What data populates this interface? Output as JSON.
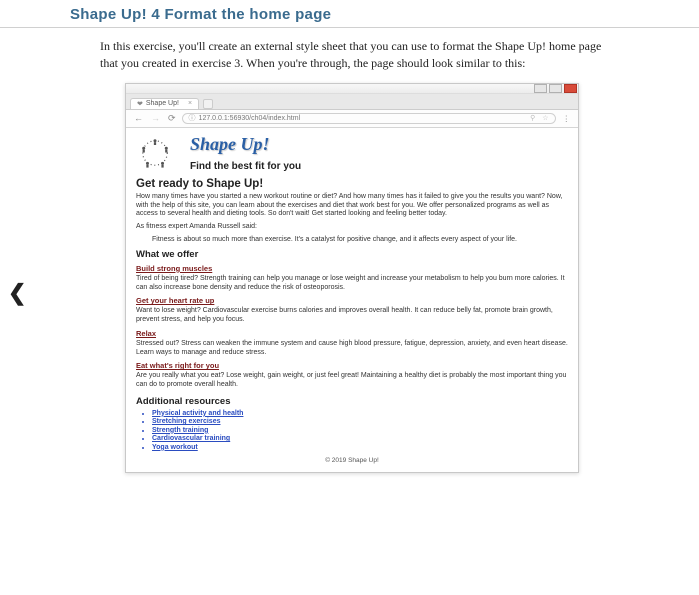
{
  "page_title": "Shape Up! 4  Format the home page",
  "intro": "In this exercise, you'll create an external style sheet that you can use to format the Shape Up! home page that you created in exercise 3. When you're through, the page should look similar to this:",
  "browser": {
    "tab_title": "Shape Up!",
    "url": "127.0.0.1:56930/ch04/index.html"
  },
  "content": {
    "hero_title": "Shape Up!",
    "hero_sub": "Find the best fit for you",
    "h_ready": "Get ready to Shape Up!",
    "p_ready": "How many times have you started a new workout routine or diet? And how many times has it failed to give you the results you want? Now, with the help of this site, you can learn about the exercises and diet that work best for you. We offer personalized programs as well as access to several health and dieting tools. So don't wait! Get started looking and feeling better today.",
    "p_expert": "As fitness expert Amanda Russell said:",
    "p_quote": "Fitness is about so much more than exercise. It's a catalyst for positive change, and it affects every aspect of your life.",
    "h_offer": "What we offer",
    "offers": [
      {
        "title": "Build strong muscles",
        "body": "Tired of being tired? Strength training can help you manage or lose weight and increase your metabolism to help you burn more calories. It can also increase bone density and reduce the risk of osteoporosis."
      },
      {
        "title": "Get your heart rate up",
        "body": "Want to lose weight? Cardiovascular exercise burns calories and improves overall health. It can reduce belly fat, promote brain growth, prevent stress, and help you focus."
      },
      {
        "title": "Relax",
        "body": "Stressed out? Stress can weaken the immune system and cause high blood pressure, fatigue, depression, anxiety, and even heart disease. Learn ways to manage and reduce stress."
      },
      {
        "title": "Eat what's right for you",
        "body": "Are you really what you eat? Lose weight, gain weight, or just feel great! Maintaining a healthy diet is probably the most important thing you can do to promote overall health."
      }
    ],
    "h_resources": "Additional resources",
    "resources": [
      "Physical activity and health",
      "Stretching exercises",
      "Strength training",
      "Cardiovascular training",
      "Yoga workout"
    ],
    "footer": "© 2019 Shape Up!"
  }
}
